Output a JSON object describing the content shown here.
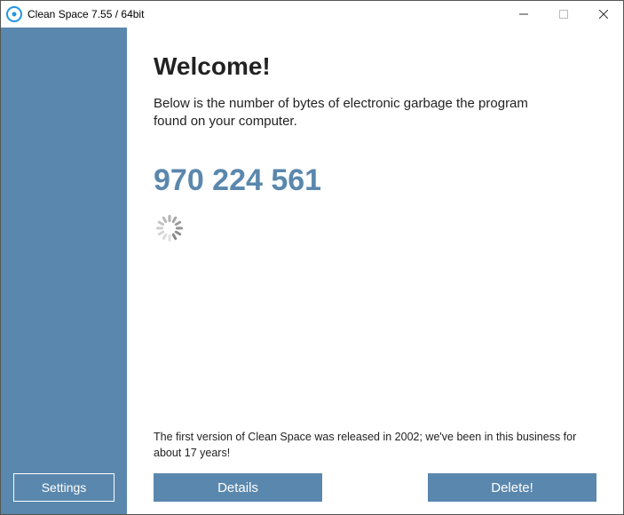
{
  "titlebar": {
    "title": "Clean Space 7.55 / 64bit"
  },
  "sidebar": {
    "settings_label": "Settings"
  },
  "main": {
    "welcome_heading": "Welcome!",
    "description": "Below is the number of bytes of electronic garbage the program found on your computer.",
    "byte_count": "970 224 561",
    "footer_note": "The first version of Clean Space was released in 2002; we've been in this business for about 17 years!",
    "details_label": "Details",
    "delete_label": "Delete!"
  },
  "colors": {
    "accent": "#5a87ad"
  }
}
